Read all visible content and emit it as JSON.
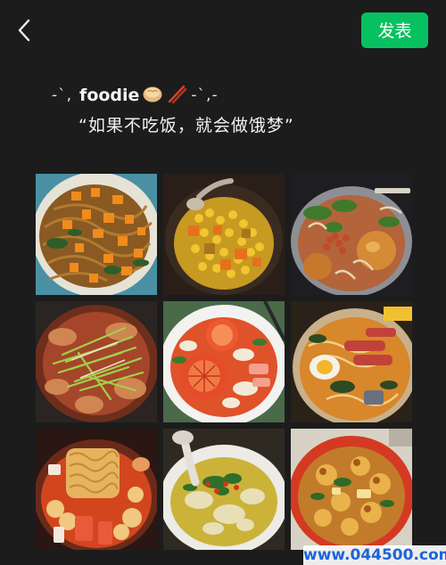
{
  "header": {
    "back_icon": "chevron-left-icon",
    "publish_label": "发表"
  },
  "post": {
    "sparkle_left": "-`,",
    "title": "foodie",
    "sparkle_right": "-`,-",
    "caption": "“如果不吃饭，就会做饿梦”"
  },
  "photos": [
    {
      "name": "photo-fried-noodles-pumpkin"
    },
    {
      "name": "photo-corn-pumpkin-stew"
    },
    {
      "name": "photo-spicy-hotpot-eggs"
    },
    {
      "name": "photo-cold-noodle-cucumber"
    },
    {
      "name": "photo-tomato-soup-bowl"
    },
    {
      "name": "photo-ramen-egg-sausage"
    },
    {
      "name": "photo-instant-noodle-hotpot"
    },
    {
      "name": "photo-sour-fish-soup"
    },
    {
      "name": "photo-braised-fish-ball-pot"
    }
  ],
  "colors": {
    "background": "#1c1c1c",
    "accent": "#07c160"
  },
  "watermark": "www.044500.com"
}
